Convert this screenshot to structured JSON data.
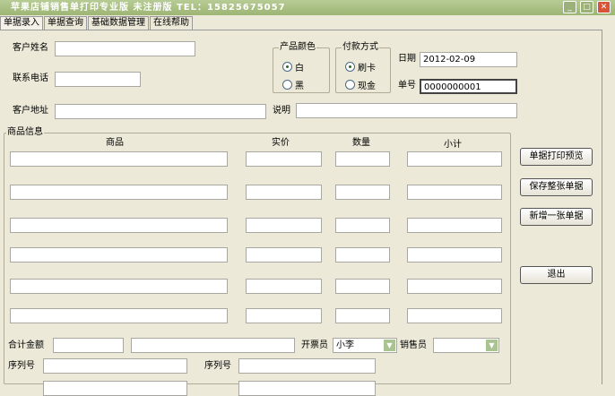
{
  "window": {
    "title": "苹果店铺销售单打印专业版 未注册版  TEL：15825675057",
    "min": "_",
    "max": "□",
    "close": "✕"
  },
  "tabs": [
    {
      "label": "单据录入"
    },
    {
      "label": "单据查询"
    },
    {
      "label": "基础数据管理"
    },
    {
      "label": "在线帮助"
    }
  ],
  "form": {
    "customer_name_label": "客户姓名",
    "phone_label": "联系电话",
    "address_label": "客户地址",
    "note_label": "说明",
    "color_group": "产品颜色",
    "color_white": "白",
    "color_black": "黑",
    "payment_group": "付款方式",
    "pay_card": "刷卡",
    "pay_cash": "现金",
    "date_label": "日期",
    "date_value": "2012-02-09",
    "number_label": "单号",
    "number_value": "0000000001"
  },
  "goods": {
    "group": "商品信息",
    "col_item": "商品",
    "col_price": "实价",
    "col_qty": "数量",
    "col_subtotal": "小计",
    "rows": 6
  },
  "buttons": {
    "preview": "单据打印预览",
    "save": "保存整张单据",
    "new": "新增一张单据",
    "exit": "退出"
  },
  "footer": {
    "total_label": "合计金额",
    "issuer_label": "开票员",
    "issuer_value": "小李",
    "seller_label": "销售员",
    "seller_value": "",
    "serial_label_1": "序列号",
    "serial_label_2": "序列号"
  }
}
